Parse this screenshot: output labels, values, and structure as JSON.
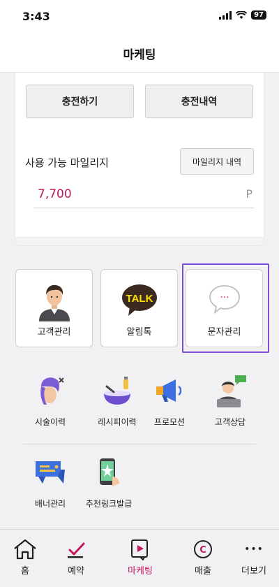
{
  "status_bar": {
    "time": "3:43",
    "battery": "97"
  },
  "header": {
    "title": "마케팅"
  },
  "mileage": {
    "charge_label": "충전하기",
    "charge_history_label": "충전내역",
    "available_label": "사용 가능 마일리지",
    "history_button_label": "마일리지 내역",
    "value": "7,700",
    "unit": "P"
  },
  "main_tiles": [
    {
      "label": "고객관리",
      "icon": "customer-avatar-icon"
    },
    {
      "label": "알림톡",
      "icon": "kakao-talk-icon",
      "icon_text": "TALK"
    },
    {
      "label": "문자관리",
      "icon": "message-bubble-icon",
      "icon_text": "···"
    }
  ],
  "menu_items": [
    {
      "label": "시술이력",
      "icon": "hair-styling-icon"
    },
    {
      "label": "레시피이력",
      "icon": "recipe-bowl-icon"
    },
    {
      "label": "프로모션",
      "icon": "megaphone-icon"
    },
    {
      "label": "고객상담",
      "icon": "consultant-icon"
    },
    {
      "label": "배너관리",
      "icon": "banner-icon"
    },
    {
      "label": "추천링크발급",
      "icon": "referral-phone-icon"
    }
  ],
  "tabs": [
    {
      "label": "홈",
      "icon": "home-icon"
    },
    {
      "label": "예약",
      "icon": "checkmark-icon"
    },
    {
      "label": "마케팅",
      "icon": "marketing-play-icon",
      "active": true
    },
    {
      "label": "매출",
      "icon": "sales-c-icon",
      "icon_text": "C"
    },
    {
      "label": "더보기",
      "icon": "more-dots-icon",
      "icon_text": "•••"
    }
  ],
  "colors": {
    "accent": "#c2185b",
    "highlight": "#7c4dd8"
  }
}
